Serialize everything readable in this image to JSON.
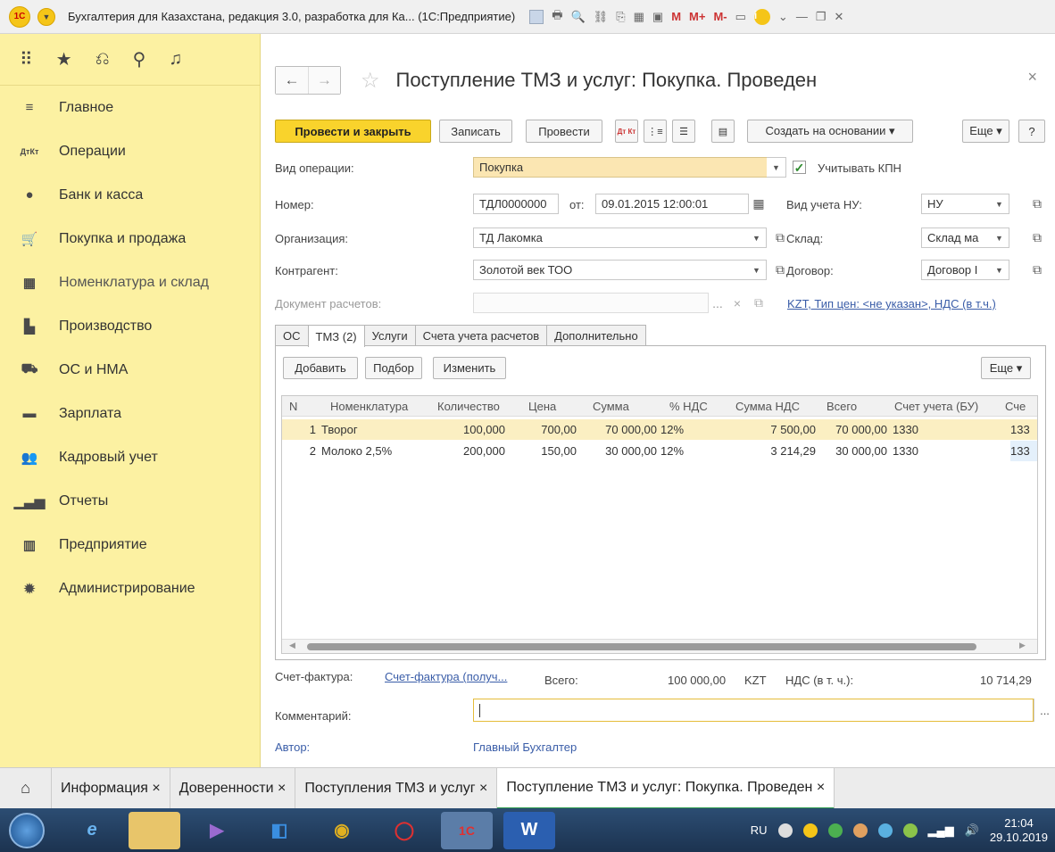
{
  "window": {
    "title": "Бухгалтерия для Казахстана, редакция 3.0, разработка для Ка... (1С:Предприятие)",
    "mm_labels": [
      "M",
      "M+",
      "M-"
    ]
  },
  "sidebar": {
    "items": [
      {
        "label": "Главное",
        "icon": "menu-lines-icon"
      },
      {
        "label": "Операции",
        "icon": "dt-kt-icon"
      },
      {
        "label": "Банк и касса",
        "icon": "coins-icon"
      },
      {
        "label": "Покупка и продажа",
        "icon": "cart-icon"
      },
      {
        "label": "Номенклатура и склад",
        "icon": "boxes-icon"
      },
      {
        "label": "Производство",
        "icon": "factory-icon"
      },
      {
        "label": "ОС и НМА",
        "icon": "truck-icon"
      },
      {
        "label": "Зарплата",
        "icon": "wallet-icon"
      },
      {
        "label": "Кадровый учет",
        "icon": "people-icon"
      },
      {
        "label": "Отчеты",
        "icon": "bar-chart-icon"
      },
      {
        "label": "Предприятие",
        "icon": "building-icon"
      },
      {
        "label": "Администрирование",
        "icon": "gear-icon"
      }
    ]
  },
  "document": {
    "title": "Поступление ТМЗ и услуг: Покупка. Проведен"
  },
  "toolbar": {
    "post_close": "Провести и закрыть",
    "save": "Записать",
    "post": "Провести",
    "dtkt_icon_label": "Дт Кт",
    "create_based": "Создать на основании ▾",
    "more": "Еще ▾",
    "help": "?"
  },
  "form": {
    "op_type_label": "Вид операции:",
    "op_type_value": "Покупка",
    "kpn_label": "Учитывать КПН",
    "kpn_checked": true,
    "number_label": "Номер:",
    "number_value": "ТДЛ0000000",
    "from_label": "от:",
    "date_value": "09.01.2015 12:00:01",
    "nu_label": "Вид учета НУ:",
    "nu_value": "НУ",
    "org_label": "Организация:",
    "org_value": "ТД Лакомка",
    "warehouse_label": "Склад:",
    "warehouse_value": "Склад ма",
    "contractor_label": "Контрагент:",
    "contractor_value": "Золотой век ТОО",
    "contract_label": "Договор:",
    "contract_value": "Договор I",
    "settlement_label": "Документ расчетов:",
    "settlement_dots": "...",
    "price_link": "KZT, Тип цен: <не указан>, НДС (в т.ч.)"
  },
  "tabs": [
    "ОС",
    "ТМЗ (2)",
    "Услуги",
    "Счета учета расчетов",
    "Дополнительно"
  ],
  "table_toolbar": {
    "add": "Добавить",
    "pick": "Подбор",
    "edit": "Изменить",
    "more": "Еще ▾"
  },
  "table": {
    "columns": [
      "N",
      "Номенклатура",
      "Количество",
      "Цена",
      "Сумма",
      "% НДС",
      "Сумма НДС",
      "Всего",
      "Счет учета (БУ)",
      "Сче"
    ],
    "rows": [
      [
        "1",
        "Творог",
        "100,000",
        "700,00",
        "70 000,00",
        "12%",
        "7 500,00",
        "70 000,00",
        "1330",
        "133"
      ],
      [
        "2",
        "Молоко 2,5%",
        "200,000",
        "150,00",
        "30 000,00",
        "12%",
        "3 214,29",
        "30 000,00",
        "1330",
        "133"
      ]
    ]
  },
  "footer": {
    "invoice_label": "Счет-фактура:",
    "invoice_link": "Счет-фактура (получ...",
    "total_label": "Всего:",
    "total_value": "100 000,00",
    "currency": "KZT",
    "vat_label": "НДС (в т. ч.):",
    "vat_value": "10 714,29",
    "comment_label": "Комментарий:",
    "comment_value": "",
    "comment_more": "...",
    "author_label": "Автор:",
    "author_value": "Главный Бухгалтер"
  },
  "bottom_tabs": [
    {
      "label": "Информация ×",
      "active": false
    },
    {
      "label": "Доверенности ×",
      "active": false
    },
    {
      "label": "Поступления ТМЗ и услуг ×",
      "active": false
    },
    {
      "label": "Поступление ТМЗ и услуг: Покупка. Проведен ×",
      "active": true
    }
  ],
  "taskbar": {
    "lang": "RU",
    "time": "21:04",
    "date": "29.10.2019"
  },
  "colors": {
    "sidebar_bg": "#fcf1a2",
    "primary_button": "#f9d32c",
    "selected_row": "#fbefc2",
    "link": "#3a5da8",
    "active_tab_accent": "#2b9a4b"
  }
}
